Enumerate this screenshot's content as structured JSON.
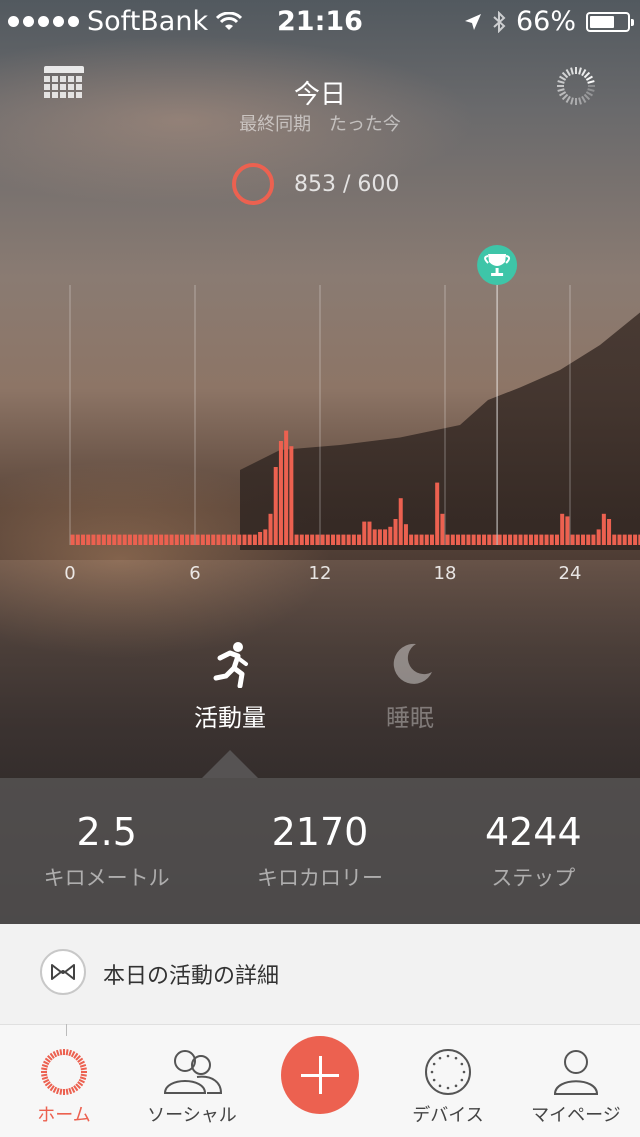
{
  "status_bar": {
    "carrier": "SoftBank",
    "time": "21:16",
    "battery": "66%",
    "battery_level": 0.66
  },
  "header": {
    "title": "今日",
    "sync_label": "最終同期",
    "sync_time": "たった今"
  },
  "goal": {
    "text": "853 / 600"
  },
  "chart_data": {
    "type": "bar",
    "title": "",
    "xlabel": "",
    "ylabel": "",
    "x_ticks": [
      "0",
      "6",
      "12",
      "18",
      "24"
    ],
    "xlim": [
      0,
      24
    ],
    "ylim": [
      0,
      100
    ],
    "bin_minutes": 15,
    "values": [
      4,
      4,
      4,
      4,
      4,
      4,
      4,
      4,
      4,
      4,
      4,
      4,
      4,
      4,
      4,
      4,
      4,
      4,
      4,
      4,
      4,
      4,
      4,
      4,
      4,
      4,
      4,
      4,
      4,
      4,
      4,
      4,
      4,
      4,
      4,
      4,
      5,
      6,
      12,
      30,
      40,
      44,
      38,
      4,
      4,
      4,
      4,
      4,
      4,
      4,
      4,
      4,
      4,
      4,
      4,
      4,
      9,
      9,
      6,
      6,
      6,
      7,
      10,
      18,
      8,
      4,
      4,
      4,
      4,
      4,
      24,
      12,
      4,
      4,
      4,
      4,
      4,
      4,
      4,
      4,
      4,
      4,
      4,
      4,
      4,
      4,
      4,
      4,
      4,
      4,
      4,
      4,
      4,
      4,
      12,
      11,
      4,
      4,
      4,
      4,
      4,
      6,
      12,
      10,
      4,
      4,
      4,
      4,
      4,
      4,
      4,
      4,
      4,
      12,
      11,
      4,
      4,
      4,
      4,
      4,
      8,
      12,
      30,
      44,
      38,
      31,
      15,
      6,
      4,
      4,
      4,
      4,
      4,
      4,
      4,
      4,
      12,
      10,
      4,
      4,
      4,
      4,
      4,
      4,
      4,
      4,
      4,
      4,
      4,
      4,
      4,
      4,
      4,
      4,
      4,
      4,
      4,
      4,
      4,
      4,
      4,
      4,
      4,
      4,
      4,
      4,
      4,
      4,
      4,
      4,
      4,
      4,
      4,
      4,
      4,
      4,
      4,
      4,
      4,
      4
    ],
    "grid": true,
    "trophy_marker_hour": 20.5
  },
  "modes": [
    {
      "label": "活動量",
      "icon": "running-icon",
      "active": true
    },
    {
      "label": "睡眠",
      "icon": "moon-icon",
      "active": false
    }
  ],
  "stats": [
    {
      "value": "2.5",
      "unit": "キロメートル"
    },
    {
      "value": "2170",
      "unit": "キロカロリー"
    },
    {
      "value": "4244",
      "unit": "ステップ"
    }
  ],
  "detail": {
    "label": "本日の活動の詳細",
    "icon": "bowtie-icon"
  },
  "tabbar": {
    "tabs": [
      {
        "label": "ホーム",
        "icon": "home-ring-icon",
        "active": true
      },
      {
        "label": "ソーシャル",
        "icon": "people-icon",
        "active": false
      },
      {
        "label": "",
        "icon": "plus-icon",
        "active": false
      },
      {
        "label": "デバイス",
        "icon": "device-icon",
        "active": false
      },
      {
        "label": "マイページ",
        "icon": "person-icon",
        "active": false
      }
    ]
  },
  "colors": {
    "accent": "#ec6150",
    "trophy": "#3ec5a8"
  }
}
